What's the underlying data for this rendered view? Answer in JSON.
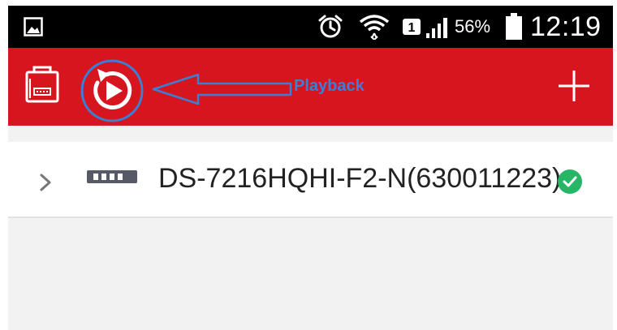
{
  "status_bar": {
    "battery_percent": "56%",
    "time": "12:19",
    "sim_slot": "1",
    "icons": [
      "gallery-icon",
      "alarm-clock-icon",
      "wifi-icon",
      "sim-card-icon",
      "signal-icon",
      "battery-icon"
    ]
  },
  "toolbar": {
    "color": "#d7151f",
    "callout_label": "Playback",
    "callout_color": "#3a7fd6",
    "icons": [
      "device-list-icon",
      "playback-icon",
      "add-icon"
    ]
  },
  "devices": [
    {
      "name": "DS-7216HQHI-F2-N(630011223)",
      "status": "online",
      "status_color": "#26b665"
    }
  ]
}
